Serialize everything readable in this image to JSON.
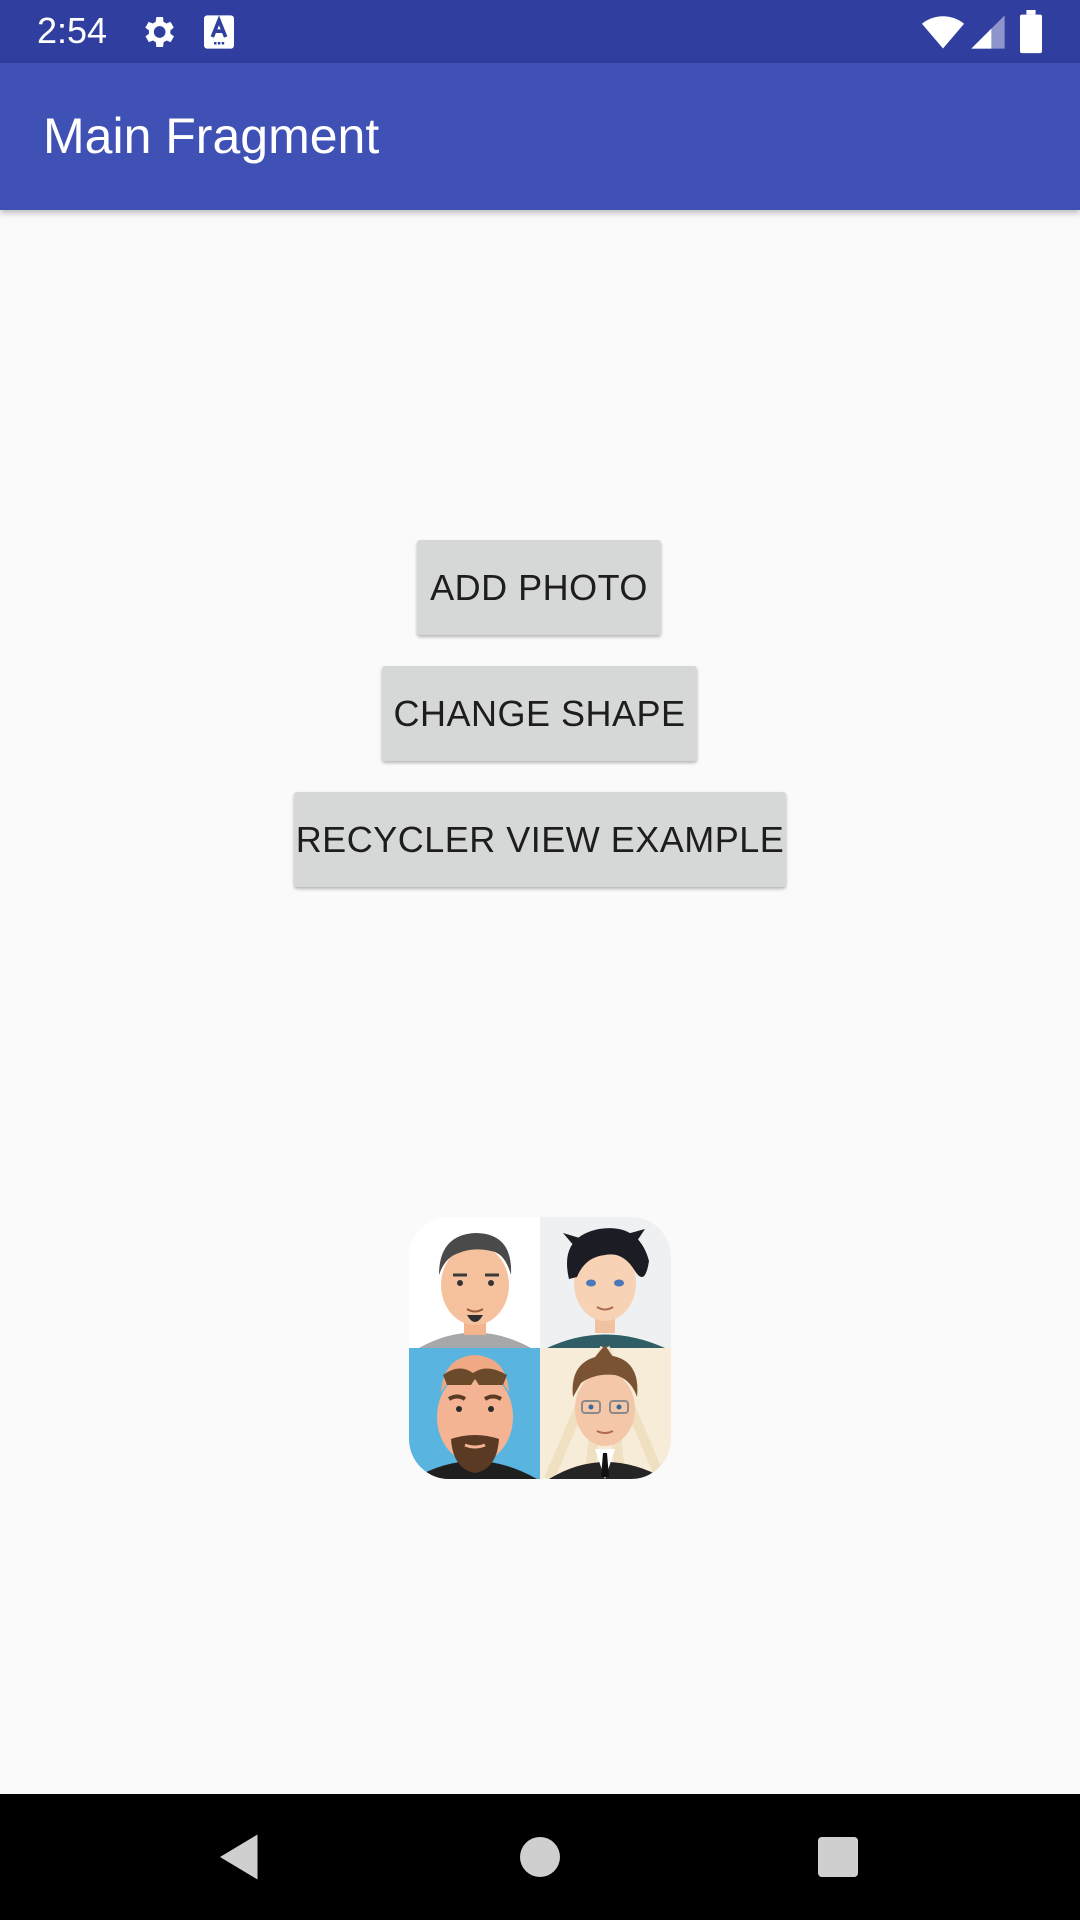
{
  "status_bar": {
    "time": "2:54",
    "left_icons": [
      "settings-gear-icon",
      "font-a-icon"
    ],
    "right_icons": [
      "wifi-icon",
      "cellular-signal-icon",
      "battery-icon"
    ],
    "background": "#303f9f"
  },
  "app_bar": {
    "title": "Main Fragment",
    "background": "#3f51b5"
  },
  "buttons": {
    "add_photo": "ADD PHOTO",
    "change_shape": "CHANGE SHAPE",
    "recycler_view_example": "RECYCLER VIEW EXAMPLE"
  },
  "avatar_collage": {
    "tiles": [
      "avatar-man-goatee",
      "avatar-young-dark-hair",
      "avatar-man-sunglasses",
      "avatar-man-glasses-suit"
    ]
  },
  "nav_bar": {
    "icons": [
      "back-icon",
      "home-icon",
      "recents-icon"
    ]
  }
}
